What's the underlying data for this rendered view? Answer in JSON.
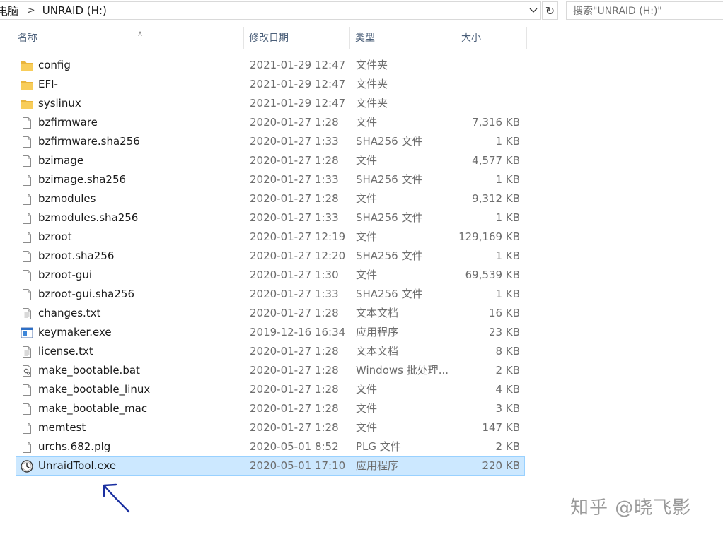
{
  "addressbar": {
    "crumbs": [
      "电脑",
      "UNRAID (H:)"
    ],
    "search_placeholder": "搜索\"UNRAID (H:)\""
  },
  "columns": {
    "name": "名称",
    "date": "修改日期",
    "type": "类型",
    "size": "大小"
  },
  "files": [
    {
      "name": "config",
      "date": "2021-01-29 12:47",
      "type": "文件夹",
      "size": "",
      "icon": "folder-icon"
    },
    {
      "name": "EFI-",
      "date": "2021-01-29 12:47",
      "type": "文件夹",
      "size": "",
      "icon": "folder-icon"
    },
    {
      "name": "syslinux",
      "date": "2021-01-29 12:47",
      "type": "文件夹",
      "size": "",
      "icon": "folder-icon"
    },
    {
      "name": "bzfirmware",
      "date": "2020-01-27 1:28",
      "type": "文件",
      "size": "7,316 KB",
      "icon": "file-icon"
    },
    {
      "name": "bzfirmware.sha256",
      "date": "2020-01-27 1:33",
      "type": "SHA256 文件",
      "size": "1 KB",
      "icon": "file-icon"
    },
    {
      "name": "bzimage",
      "date": "2020-01-27 1:28",
      "type": "文件",
      "size": "4,577 KB",
      "icon": "file-icon"
    },
    {
      "name": "bzimage.sha256",
      "date": "2020-01-27 1:33",
      "type": "SHA256 文件",
      "size": "1 KB",
      "icon": "file-icon"
    },
    {
      "name": "bzmodules",
      "date": "2020-01-27 1:28",
      "type": "文件",
      "size": "9,312 KB",
      "icon": "file-icon"
    },
    {
      "name": "bzmodules.sha256",
      "date": "2020-01-27 1:33",
      "type": "SHA256 文件",
      "size": "1 KB",
      "icon": "file-icon"
    },
    {
      "name": "bzroot",
      "date": "2020-01-27 12:19",
      "type": "文件",
      "size": "129,169 KB",
      "icon": "file-icon"
    },
    {
      "name": "bzroot.sha256",
      "date": "2020-01-27 12:20",
      "type": "SHA256 文件",
      "size": "1 KB",
      "icon": "file-icon"
    },
    {
      "name": "bzroot-gui",
      "date": "2020-01-27 1:30",
      "type": "文件",
      "size": "69,539 KB",
      "icon": "file-icon"
    },
    {
      "name": "bzroot-gui.sha256",
      "date": "2020-01-27 1:33",
      "type": "SHA256 文件",
      "size": "1 KB",
      "icon": "file-icon"
    },
    {
      "name": "changes.txt",
      "date": "2020-01-27 1:28",
      "type": "文本文档",
      "size": "16 KB",
      "icon": "text-file-icon"
    },
    {
      "name": "keymaker.exe",
      "date": "2019-12-16 16:34",
      "type": "应用程序",
      "size": "23 KB",
      "icon": "application-icon"
    },
    {
      "name": "license.txt",
      "date": "2020-01-27 1:28",
      "type": "文本文档",
      "size": "8 KB",
      "icon": "text-file-icon"
    },
    {
      "name": "make_bootable.bat",
      "date": "2020-01-27 1:28",
      "type": "Windows 批处理...",
      "size": "2 KB",
      "icon": "batch-file-icon"
    },
    {
      "name": "make_bootable_linux",
      "date": "2020-01-27 1:28",
      "type": "文件",
      "size": "4 KB",
      "icon": "file-icon"
    },
    {
      "name": "make_bootable_mac",
      "date": "2020-01-27 1:28",
      "type": "文件",
      "size": "3 KB",
      "icon": "file-icon"
    },
    {
      "name": "memtest",
      "date": "2020-01-27 1:28",
      "type": "文件",
      "size": "147 KB",
      "icon": "file-icon"
    },
    {
      "name": "urchs.682.plg",
      "date": "2020-05-01 8:52",
      "type": "PLG 文件",
      "size": "2 KB",
      "icon": "file-icon"
    },
    {
      "name": "UnraidTool.exe",
      "date": "2020-05-01 17:10",
      "type": "应用程序",
      "size": "220 KB",
      "icon": "clock-app-icon",
      "selected": true
    }
  ],
  "watermark": "知乎 @晓飞影",
  "colors": {
    "selection_bg": "#cce8ff",
    "selection_border": "#99d1ff",
    "folder": "#f4c04e",
    "header_text": "#4c607a",
    "annotation": "#1a2fa0"
  }
}
